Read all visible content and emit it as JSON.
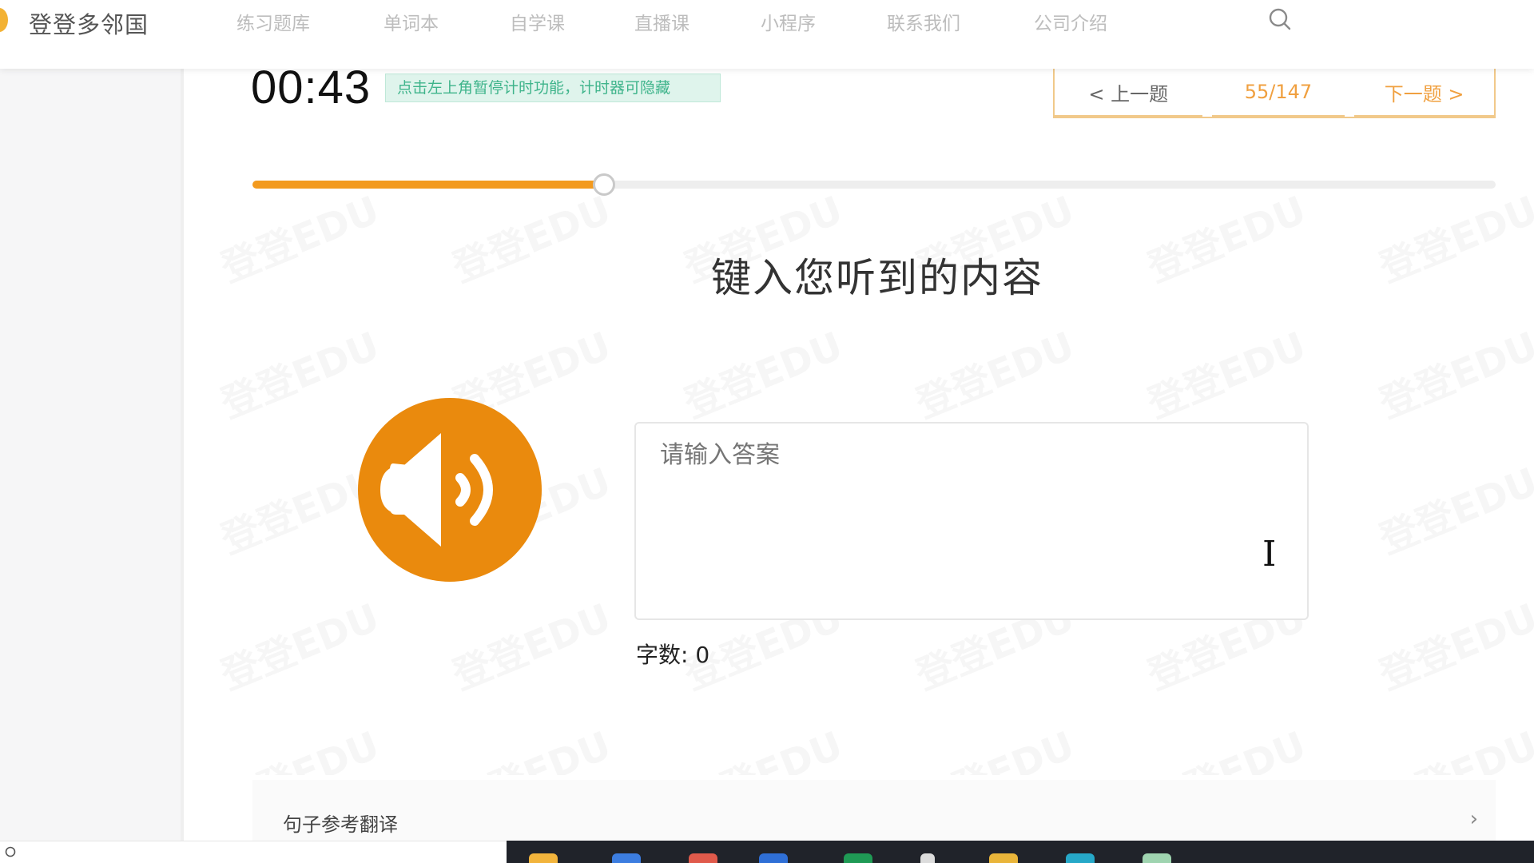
{
  "nav": {
    "brand": "登登多邻国",
    "items": [
      "练习题库",
      "单词本",
      "自学课",
      "直播课",
      "小程序",
      "联系我们",
      "公司介绍"
    ]
  },
  "quiz": {
    "timer": "00:43",
    "timer_hint": "点击左上角暂停计时功能，计时器可隐藏",
    "pager": {
      "prev": "< 上一题",
      "count": "55/147",
      "next": "下一题 >"
    },
    "progress_fraction": 0.283,
    "title": "键入您听到的内容",
    "answer_placeholder": "请输入答案",
    "char_count": "字数: 0",
    "reference_label": "句子参考翻译"
  },
  "watermark_text": "登登EDU",
  "colors": {
    "accent": "#ea8a0d",
    "progress": "#f39a1e",
    "pager_text": "#f0a040",
    "hint_bg": "#dff4ec",
    "hint_text": "#3fb48b"
  },
  "icons": {
    "search": "search-icon",
    "speaker": "speaker-icon",
    "chevron": "chevron-right-icon"
  }
}
